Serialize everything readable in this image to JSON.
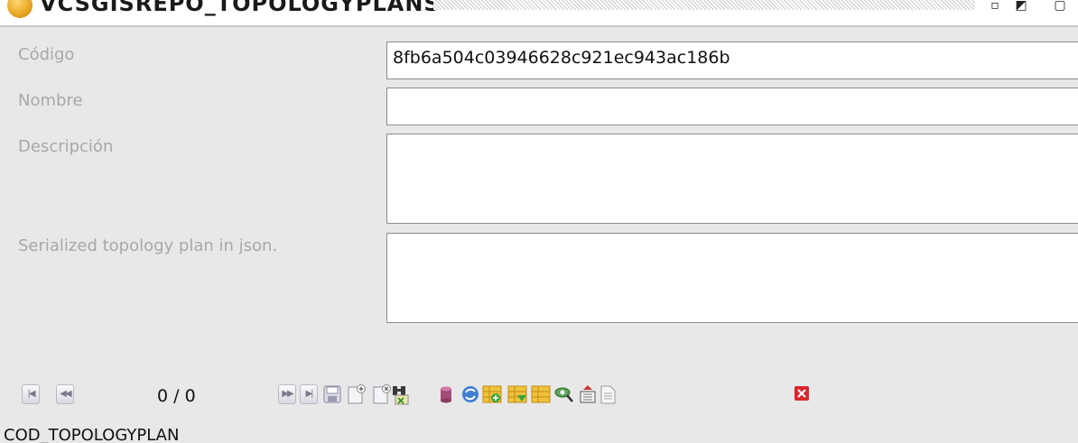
{
  "window": {
    "title": "VCSGISREPO_TOPOLOGYPLANS"
  },
  "form": {
    "codigo_label": "Código",
    "codigo_value": "8fb6a504c03946628c921ec943ac186b",
    "nombre_label": "Nombre",
    "nombre_value": "",
    "descripcion_label": "Descripción",
    "descripcion_value": "",
    "serialized_label": "Serialized topology plan in json.",
    "serialized_value": ""
  },
  "toolbar": {
    "counter": "0 / 0",
    "icons": [
      "first-record-icon",
      "previous-record-icon",
      "next-record-icon",
      "last-record-icon",
      "save-icon",
      "new-record-icon",
      "delete-record-icon",
      "search-binoculars-icon",
      "database-icon",
      "refresh-icon",
      "table-add-icon",
      "table-filter-icon",
      "table-icon",
      "inspect-icon",
      "export-icon",
      "report-icon",
      "close-icon"
    ]
  },
  "table": {
    "column_header": "COD_TOPOLOGYPLAN"
  },
  "colors": {
    "background": "#e8e8e8",
    "label_text": "#a8a8a8",
    "field_border": "#8c8c8c",
    "close_red": "#d9262c"
  }
}
